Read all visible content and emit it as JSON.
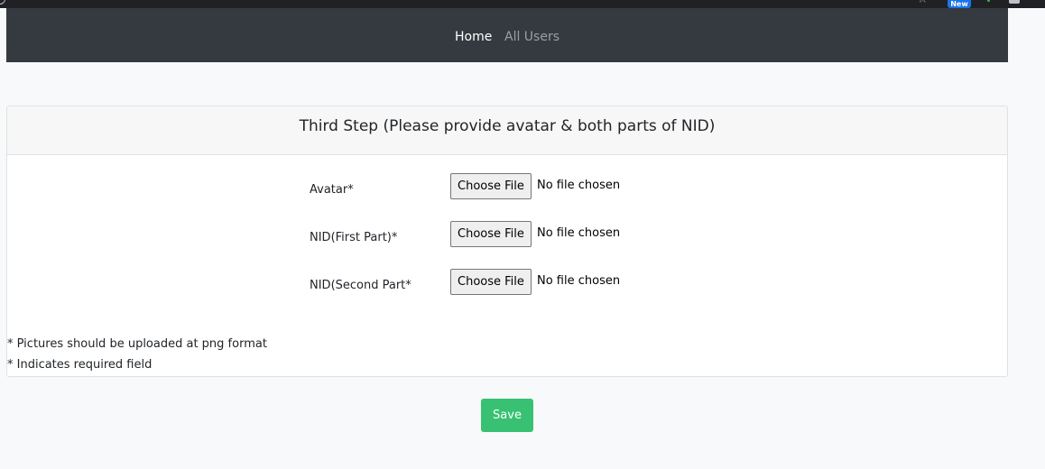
{
  "browser": {
    "badge_text": "New"
  },
  "nav": {
    "home": "Home",
    "all_users": "All Users"
  },
  "card": {
    "title": "Third Step (Please provide avatar & both parts of NID)",
    "fields": [
      {
        "label": "Avatar*",
        "button": "Choose File",
        "status": "No file chosen"
      },
      {
        "label": "NID(First Part)*",
        "button": "Choose File",
        "status": "No file chosen"
      },
      {
        "label": "NID(Second Part*",
        "button": "Choose File",
        "status": "No file chosen"
      }
    ],
    "notes": [
      "* Pictures should be uploaded at png format",
      "* Indicates required field"
    ]
  },
  "save_label": "Save",
  "colors": {
    "navbar": "#343a40",
    "save": "#38c172",
    "page_bg": "#f8f9fa"
  }
}
